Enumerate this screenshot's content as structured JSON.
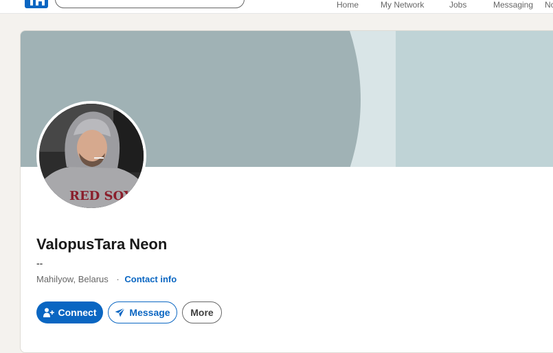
{
  "nav": {
    "items": [
      {
        "label": "Home"
      },
      {
        "label": "My Network"
      },
      {
        "label": "Jobs"
      },
      {
        "label": "Messaging"
      },
      {
        "label": "No"
      }
    ]
  },
  "profile": {
    "name": "ValopusTara Neon",
    "headline": "--",
    "location": "Mahilyow, Belarus",
    "separator": "·",
    "contact_info": "Contact info"
  },
  "actions": {
    "connect": "Connect",
    "message": "Message",
    "more": "More"
  },
  "colors": {
    "brand": "#0a66c2",
    "page_bg": "#f4f2ee",
    "banner_dark": "#a0b2b5",
    "banner_light": "#d9e5e7",
    "banner_right": "#bfd3d6"
  }
}
